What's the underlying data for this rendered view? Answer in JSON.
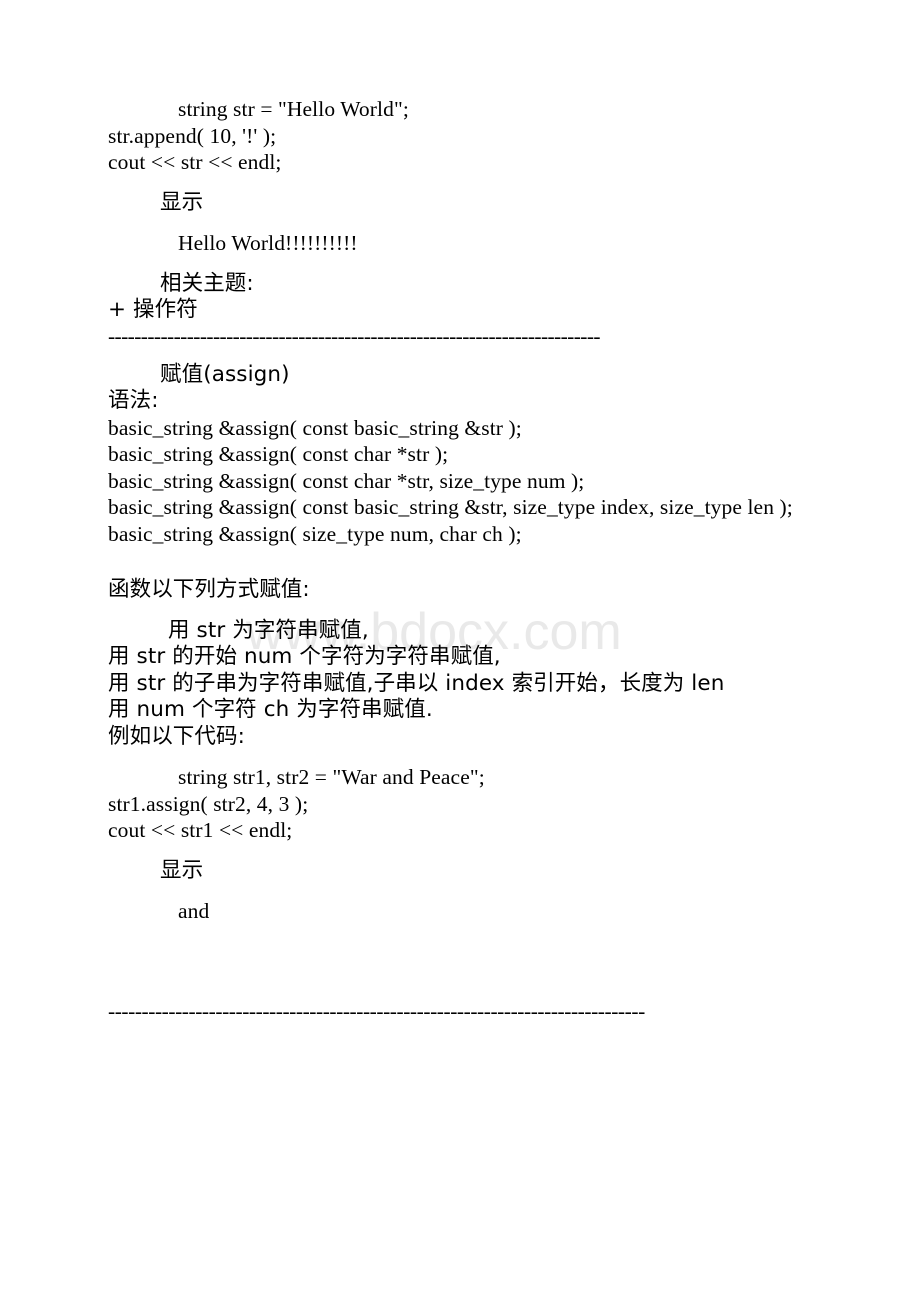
{
  "document": {
    "watermark": "www.bdocx.com",
    "sections": {
      "append_example": {
        "code_lines": [
          "string str = \"Hello World\";",
          "str.append( 10, '!' );",
          "cout << str << endl;"
        ],
        "display_label": "显示",
        "output": "Hello World!!!!!!!!!!",
        "related_label": "相关主题:",
        "related_item": "+ 操作符"
      },
      "separator_top": "---------------------------------------------------------------------------",
      "assign": {
        "heading": "赋值(assign)",
        "syntax_label": "语法:",
        "signatures": [
          "basic_string &assign( const basic_string &str );",
          "basic_string &assign( const char *str );",
          "basic_string &assign( const char *str, size_type num );",
          "basic_string &assign( const basic_string &str, size_type index, size_type len );",
          "basic_string &assign( size_type num, char ch );"
        ],
        "description_intro": "函数以下列方式赋值:",
        "description_items": [
          "用 str 为字符串赋值,",
          "用 str 的开始 num 个字符为字符串赋值,",
          "用 str 的子串为字符串赋值,子串以 index 索引开始，长度为 len",
          "用 num 个字符 ch 为字符串赋值."
        ],
        "example_label": "例如以下代码:",
        "code_lines": [
          "string str1, str2 = \"War and Peace\";",
          "str1.assign( str2, 4, 3 );",
          "cout << str1 << endl;"
        ],
        "display_label": "显示",
        "output": "and"
      },
      "separator_bottom": "--------------------------------------------------------------------------------"
    }
  }
}
